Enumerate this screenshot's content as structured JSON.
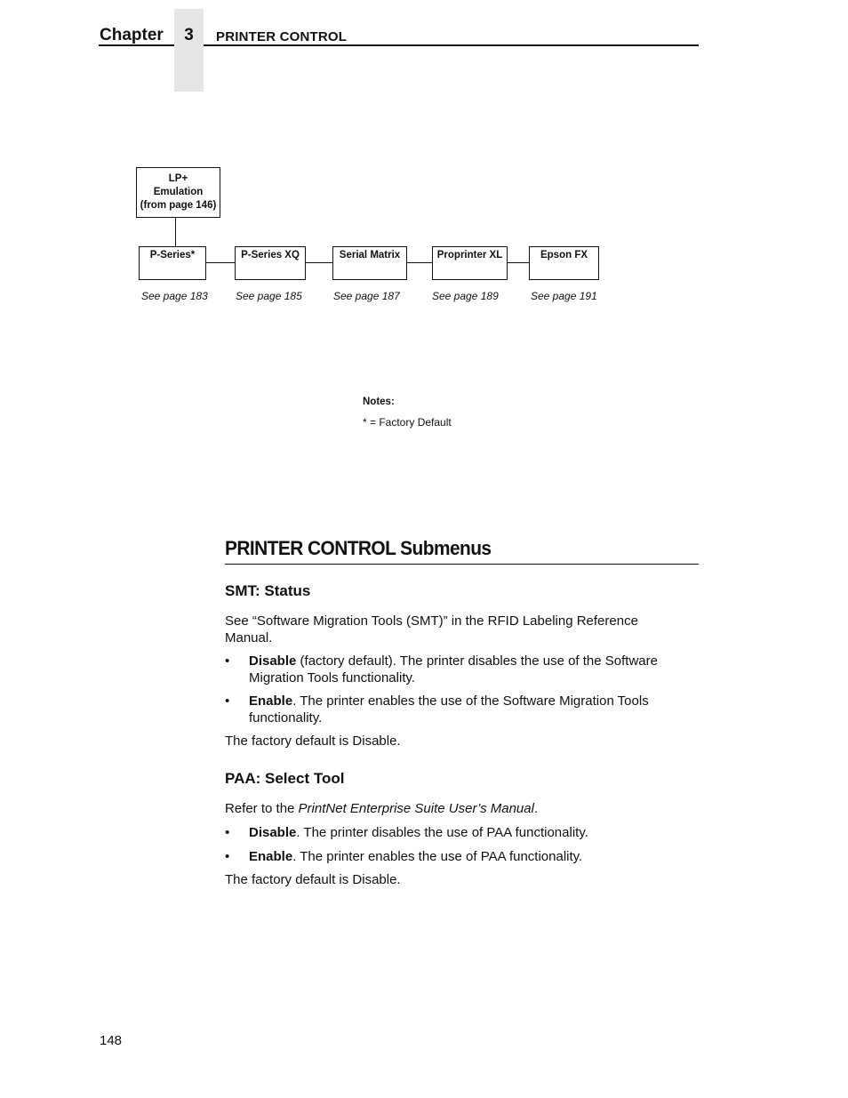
{
  "header": {
    "chapter_label": "Chapter",
    "chapter_number": "3",
    "chapter_title": "PRINTER CONTROL"
  },
  "diagram": {
    "root": {
      "line1": "LP+",
      "line2": "Emulation",
      "line3": "(from page 146)"
    },
    "children": [
      {
        "label": "P-Series*",
        "see": "See page 183"
      },
      {
        "label": "P-Series XQ",
        "see": "See page 185"
      },
      {
        "label": "Serial Matrix",
        "see": "See page 187"
      },
      {
        "label": "Proprinter XL",
        "see": "See page 189"
      },
      {
        "label": "Epson FX",
        "see": "See page 191"
      }
    ],
    "notes": {
      "title": "Notes:",
      "line": "* = Factory Default"
    }
  },
  "section": {
    "title": "PRINTER CONTROL Submenus",
    "smt": {
      "heading": "SMT: Status",
      "intro_line1": "See “Software Migration Tools (SMT)” in the RFID Labeling Reference",
      "intro_line2": "Manual.",
      "bullets": [
        {
          "bold": "Disable",
          "rest_line1": " (factory default). The printer disables the use of the Software",
          "rest_line2": "Migration Tools functionality."
        },
        {
          "bold": "Enable",
          "rest_line1": ". The printer enables the use of the Software Migration Tools",
          "rest_line2": "functionality."
        }
      ],
      "default_text": "The factory default is Disable."
    },
    "paa": {
      "heading": "PAA: Select Tool",
      "intro_prefix": "Refer to the ",
      "intro_italic": "PrintNet Enterprise Suite User’s Manual",
      "intro_suffix": ".",
      "bullets": [
        {
          "bold": "Disable",
          "rest": ". The printer disables the use of PAA functionality."
        },
        {
          "bold": "Enable",
          "rest": ". The printer enables the use of PAA functionality."
        }
      ],
      "default_text": "The factory default is Disable."
    }
  },
  "footer": {
    "page_number": "148"
  }
}
